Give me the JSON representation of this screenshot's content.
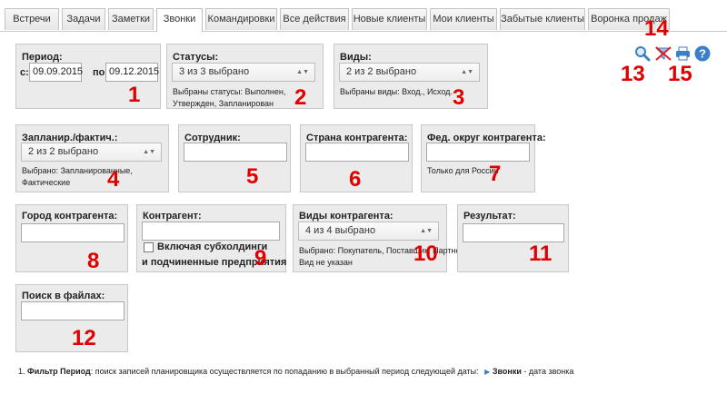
{
  "tabs": [
    "Встречи",
    "Задачи",
    "Заметки",
    "Звонки",
    "Командировки",
    "Все действия",
    "Новые клиенты",
    "Мои клиенты",
    "Забытые клиенты",
    "Воронка продаж"
  ],
  "period": {
    "title": "Период:",
    "from_label": "с:",
    "from_value": "09.09.2015",
    "to_label": "по:",
    "to_value": "09.12.2015"
  },
  "statuses": {
    "title": "Статусы:",
    "selected": "3 из 3 выбрано",
    "note": "Выбраны статусы: Выполнен, Утвержден, Запланирован"
  },
  "kinds": {
    "title": "Виды:",
    "selected": "2 из 2 выбрано",
    "note": "Выбраны виды: Вход., Исход."
  },
  "planned": {
    "title": "Запланир./фактич.:",
    "selected": "2 из 2 выбрано",
    "note": "Выбрано: Запланированные, Фактические"
  },
  "employee": {
    "title": "Сотрудник:",
    "value": ""
  },
  "country": {
    "title": "Страна контрагента:",
    "value": ""
  },
  "district": {
    "title": "Фед. округ контрагента:",
    "value": "",
    "note": "Только для России"
  },
  "city": {
    "title": "Город контрагента:",
    "value": ""
  },
  "contractor": {
    "title": "Контрагент:",
    "value": "",
    "checkbox_line1": "Включая субхолдинги",
    "checkbox_line2": "и подчиненные предприятия"
  },
  "ctypes": {
    "title": "Виды контрагента:",
    "selected": "4 из 4 выбрано",
    "note_line1": "Выбрано: Покупатель, Поставщик, Партнер,",
    "note_line2": "Вид не указан"
  },
  "result": {
    "title": "Результат:",
    "value": ""
  },
  "filesearch": {
    "title": "Поиск в файлах:",
    "value": ""
  },
  "footer": {
    "prefix": "1. ",
    "bold": "Фильтр Период",
    "text": ": поиск записей планировщика осуществляется по попаданию в выбранный период следующей даты:",
    "link": "Звонки",
    "suffix": " - дата звонка"
  },
  "markers": [
    "1",
    "2",
    "3",
    "4",
    "5",
    "6",
    "7",
    "8",
    "9",
    "10",
    "11",
    "12",
    "13",
    "14",
    "15"
  ],
  "icons": {
    "search": "search-icon",
    "clear": "clear-filter-icon",
    "print": "print-icon",
    "help": "help-icon",
    "help_glyph": "?"
  },
  "colors": {
    "marker": "#e00000",
    "icon_blue": "#3a7fc8",
    "panel": "#ebebeb"
  }
}
